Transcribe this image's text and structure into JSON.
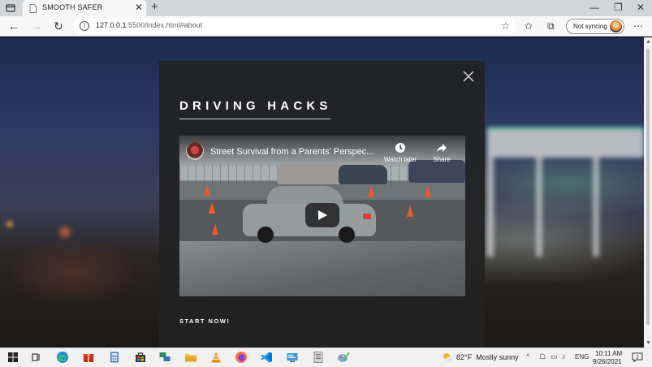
{
  "browser": {
    "tab_title": "SMOOTH SAFER",
    "new_tab_label": "+",
    "url_host": "127.0.0.1",
    "url_rest": ":5500/index.html#about",
    "sync_label": "Not syncing",
    "info_glyph": "i",
    "icons": {
      "back": "arrow-left-icon",
      "forward": "arrow-right-icon",
      "reload": "reload-icon",
      "favorites": "star-icon",
      "collections": "collections-icon",
      "menu": "more-icon"
    }
  },
  "modal": {
    "title": "DRIVING HACKS",
    "cta_label": "START NOW!",
    "video": {
      "title": "Street Survival from a Parents' Perspec...",
      "watch_later_label": "Watch later",
      "share_label": "Share"
    }
  },
  "taskbar": {
    "weather": {
      "temperature": "82°F",
      "condition": "Mostly sunny"
    },
    "language": "ENG",
    "time": "10:11 AM",
    "date": "9/26/2021",
    "notification_count": "2"
  },
  "colors": {
    "modal_bg": "#222224",
    "accent_blue": "#2f7bd6",
    "play_button": "#212121",
    "cone": "#ee5a2b"
  }
}
